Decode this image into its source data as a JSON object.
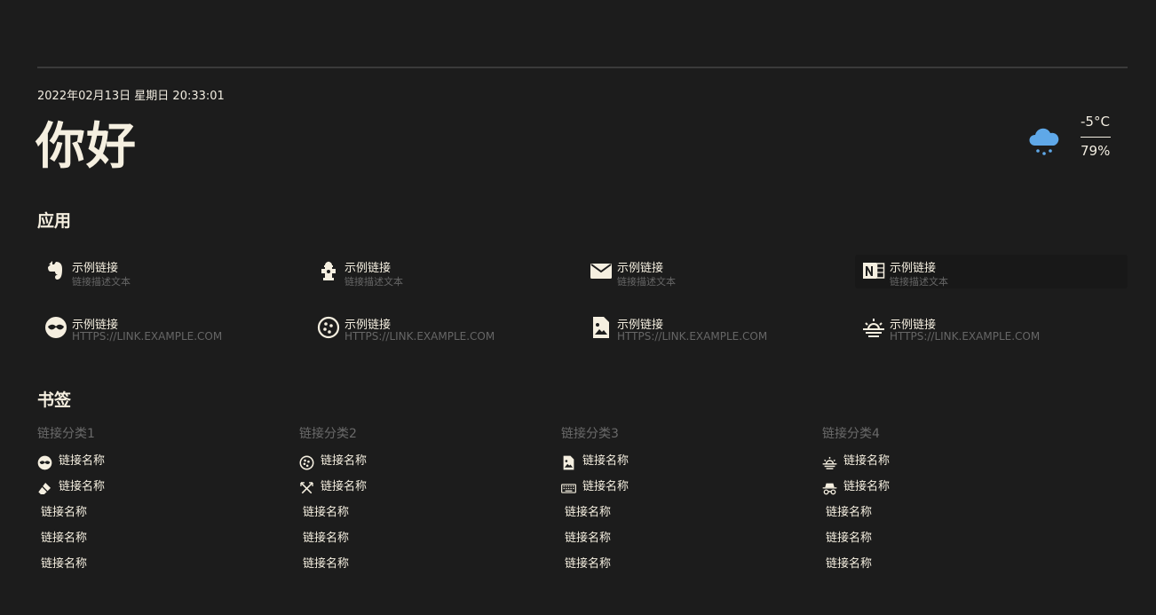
{
  "header": {
    "datetime": "2022年02月13日 星期日 20:33:01",
    "greeting": "你好"
  },
  "weather": {
    "icon": "cloud-snow-icon",
    "temperature": "-5°C",
    "humidity": "79%",
    "icon_color": "#5fa8e8"
  },
  "apps": {
    "title": "应用",
    "items": [
      {
        "name": "示例链接",
        "desc": "链接描述文本",
        "icon": "evernote-icon"
      },
      {
        "name": "示例链接",
        "desc": "链接描述文本",
        "icon": "fire-hydrant-icon"
      },
      {
        "name": "示例链接",
        "desc": "链接描述文本",
        "icon": "email-icon"
      },
      {
        "name": "示例链接",
        "desc": "链接描述文本",
        "icon": "onenote-icon"
      },
      {
        "name": "示例链接",
        "desc": "HTTPS://LINK.EXAMPLE.COM",
        "icon": "mask-icon"
      },
      {
        "name": "示例链接",
        "desc": "HTTPS://LINK.EXAMPLE.COM",
        "icon": "cookie-icon"
      },
      {
        "name": "示例链接",
        "desc": "HTTPS://LINK.EXAMPLE.COM",
        "icon": "file-image-icon"
      },
      {
        "name": "示例链接",
        "desc": "HTTPS://LINK.EXAMPLE.COM",
        "icon": "sunset-icon"
      }
    ]
  },
  "bookmarks": {
    "title": "书签",
    "groups": [
      {
        "category": "链接分类1",
        "items": [
          {
            "label": "链接名称",
            "icon": "mask-icon"
          },
          {
            "label": "链接名称",
            "icon": "eraser-icon"
          },
          {
            "label": "链接名称",
            "icon": ""
          },
          {
            "label": "链接名称",
            "icon": ""
          },
          {
            "label": "链接名称",
            "icon": ""
          }
        ]
      },
      {
        "category": "链接分类2",
        "items": [
          {
            "label": "链接名称",
            "icon": "cookie-icon"
          },
          {
            "label": "链接名称",
            "icon": "sword-cross-icon"
          },
          {
            "label": "链接名称",
            "icon": ""
          },
          {
            "label": "链接名称",
            "icon": ""
          },
          {
            "label": "链接名称",
            "icon": ""
          }
        ]
      },
      {
        "category": "链接分类3",
        "items": [
          {
            "label": "链接名称",
            "icon": "file-image-icon"
          },
          {
            "label": "链接名称",
            "icon": "keyboard-icon"
          },
          {
            "label": "链接名称",
            "icon": ""
          },
          {
            "label": "链接名称",
            "icon": ""
          },
          {
            "label": "链接名称",
            "icon": ""
          }
        ]
      },
      {
        "category": "链接分类4",
        "items": [
          {
            "label": "链接名称",
            "icon": "sunset-icon"
          },
          {
            "label": "链接名称",
            "icon": "incognito-icon"
          },
          {
            "label": "链接名称",
            "icon": ""
          },
          {
            "label": "链接名称",
            "icon": ""
          },
          {
            "label": "链接名称",
            "icon": ""
          }
        ]
      }
    ]
  },
  "colors": {
    "background": "#1c1c1c",
    "text": "#f5efe0",
    "muted": "#666666",
    "divider": "#3a3a3a"
  }
}
